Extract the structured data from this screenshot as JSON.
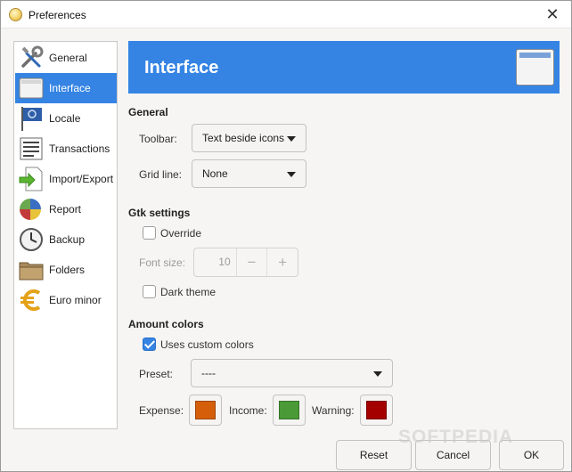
{
  "window": {
    "title": "Preferences",
    "close_glyph": "✕"
  },
  "sidebar": {
    "items": [
      {
        "label": "General",
        "icon": "tools-icon",
        "active": false
      },
      {
        "label": "Interface",
        "icon": "window-icon",
        "active": true
      },
      {
        "label": "Locale",
        "icon": "flag-icon",
        "active": false
      },
      {
        "label": "Transactions",
        "icon": "list-icon",
        "active": false
      },
      {
        "label": "Import/Export",
        "icon": "import-export-icon",
        "active": false
      },
      {
        "label": "Report",
        "icon": "pie-chart-icon",
        "active": false
      },
      {
        "label": "Backup",
        "icon": "clock-icon",
        "active": false
      },
      {
        "label": "Folders",
        "icon": "folder-icon",
        "active": false
      },
      {
        "label": "Euro minor",
        "icon": "euro-icon",
        "active": false
      }
    ]
  },
  "banner": {
    "title": "Interface",
    "icon": "window-icon"
  },
  "general": {
    "title": "General",
    "toolbar_label": "Toolbar:",
    "toolbar_value": "Text beside icons",
    "gridline_label": "Grid line:",
    "gridline_value": "None"
  },
  "gtk": {
    "title": "Gtk settings",
    "override_label": "Override",
    "override_checked": false,
    "fontsize_label": "Font size:",
    "fontsize_value": "10",
    "minus": "−",
    "plus": "+",
    "dark_label": "Dark theme",
    "dark_checked": false
  },
  "amount": {
    "title": "Amount colors",
    "custom_label": "Uses custom colors",
    "custom_checked": true,
    "preset_label": "Preset:",
    "preset_value": "----",
    "expense_label": "Expense:",
    "expense_color": "#d45e0a",
    "income_label": "Income:",
    "income_color": "#4a9a38",
    "warning_label": "Warning:",
    "warning_color": "#a40000"
  },
  "buttons": {
    "reset": "Reset",
    "cancel": "Cancel",
    "ok": "OK"
  },
  "colors": {
    "accent": "#3584e4"
  },
  "watermark": "SOFTPEDIA"
}
